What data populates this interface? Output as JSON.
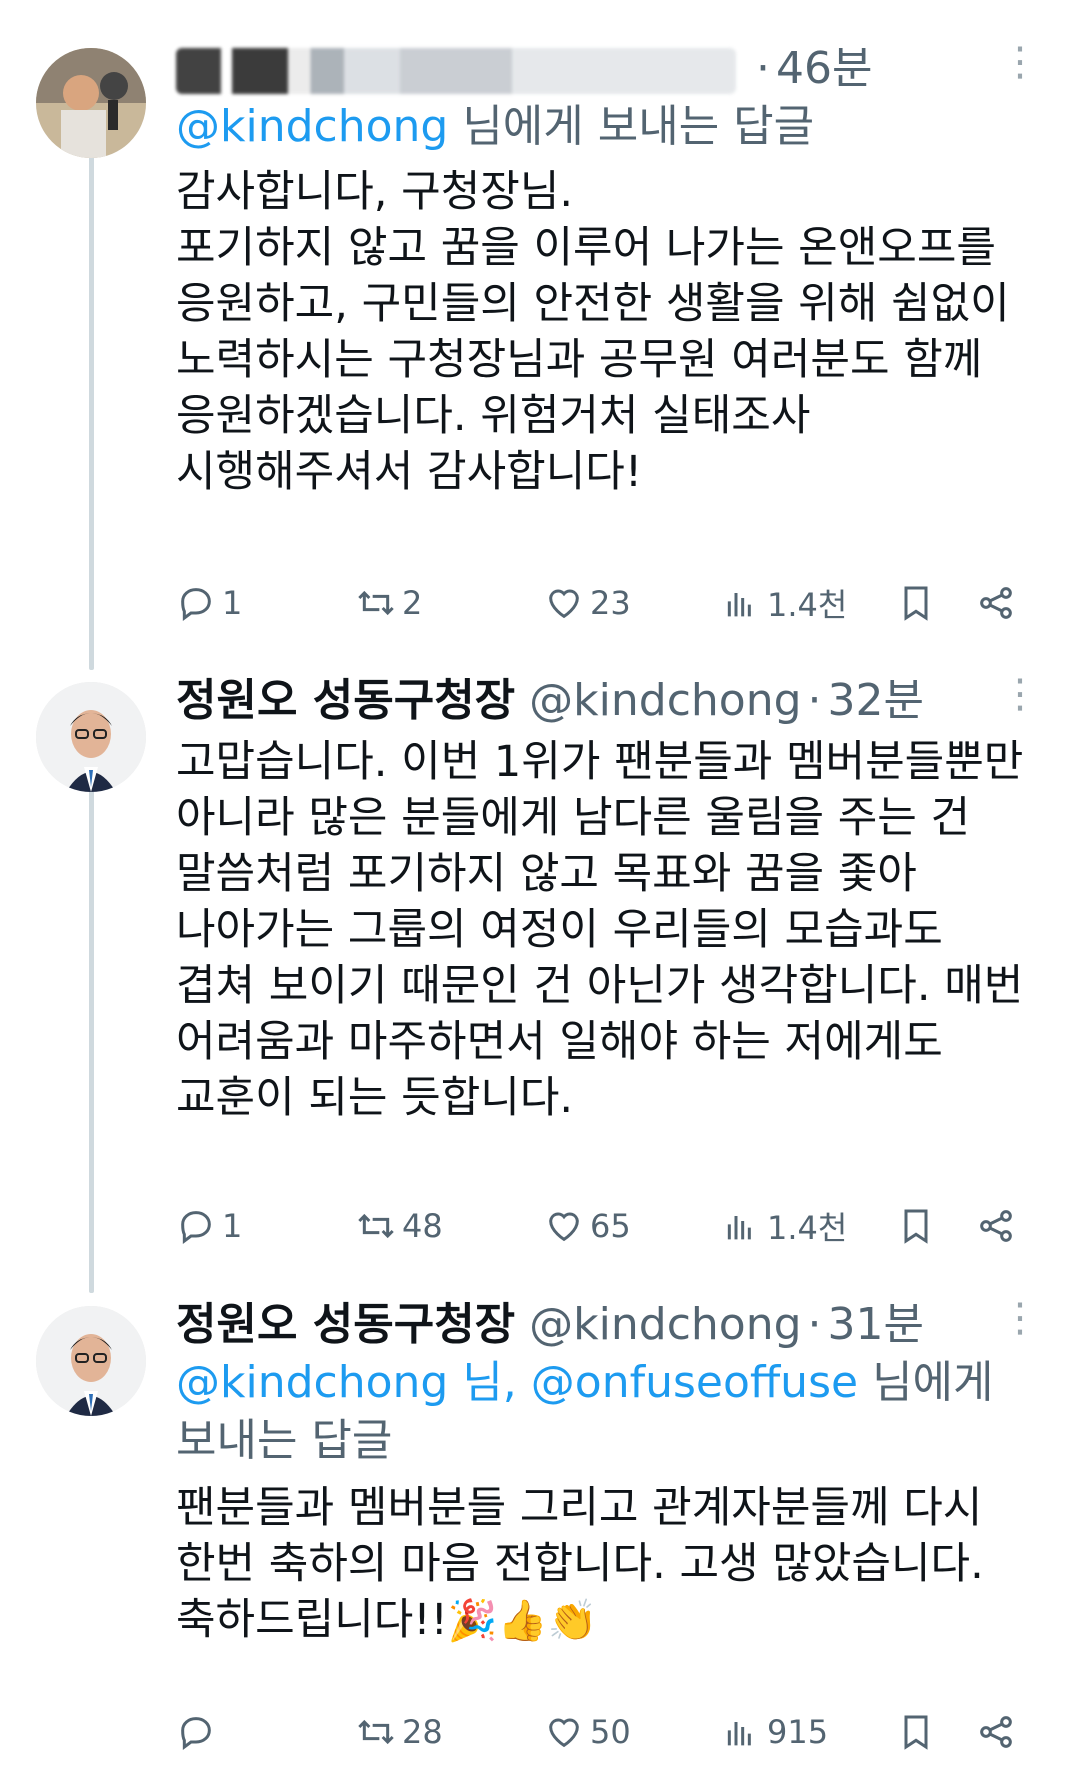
{
  "tweets": [
    {
      "name": "",
      "handle": "",
      "time": "46분",
      "reply_to_users": [
        "@kindchong"
      ],
      "reply_to_suffix": " 님에게 보내는 답글",
      "reply_to_prefix_plain": "",
      "body": "감사합니다, 구청장님.\n포기하지 않고 꿈을 이루어 나가는 온앤오프를\n응원하고, 구민들의 안전한 생활을 위해 쉼없이\n노력하시는 구청장님과 공무원 여러분도 함께\n응원하겠습니다. 위험거처 실태조사\n시행해주셔서 감사합니다!",
      "stats": {
        "replies": "1",
        "retweets": "2",
        "likes": "23",
        "views": "1.4천"
      }
    },
    {
      "name": "정원오 성동구청장",
      "handle": "@kindchong",
      "time": "32분",
      "body": "고맙습니다. 이번 1위가 팬분들과 멤버분들뿐만\n아니라 많은 분들에게 남다른 울림을 주는 건\n말씀처럼 포기하지 않고 목표와 꿈을 좇아\n나아가는 그룹의 여정이 우리들의 모습과도\n겹쳐 보이기 때문인 건 아닌가 생각합니다. 매번\n어려움과 마주하면서 일해야 하는 저에게도\n교훈이 되는 듯합니다.",
      "stats": {
        "replies": "1",
        "retweets": "48",
        "likes": "65",
        "views": "1.4천"
      }
    },
    {
      "name": "정원오 성동구청장",
      "handle": "@kindchong",
      "time": "31분",
      "reply_to_line1_link": "@kindchong 님, @onfuseoffuse",
      "reply_to_line1_suffix": " 님에게",
      "reply_to_line2": "보내는 답글",
      "body": "팬분들과 멤버분들 그리고 관계자분들께 다시\n한번 축하의 마음 전합니다. 고생 많았습니다.\n축하드립니다!!",
      "emojis": "🎉👍👏",
      "stats": {
        "replies": "",
        "retweets": "28",
        "likes": "50",
        "views": "915"
      }
    }
  ],
  "colors": {
    "link": "#1d9bf0",
    "secondary": "#536471",
    "text": "#0f1419"
  }
}
